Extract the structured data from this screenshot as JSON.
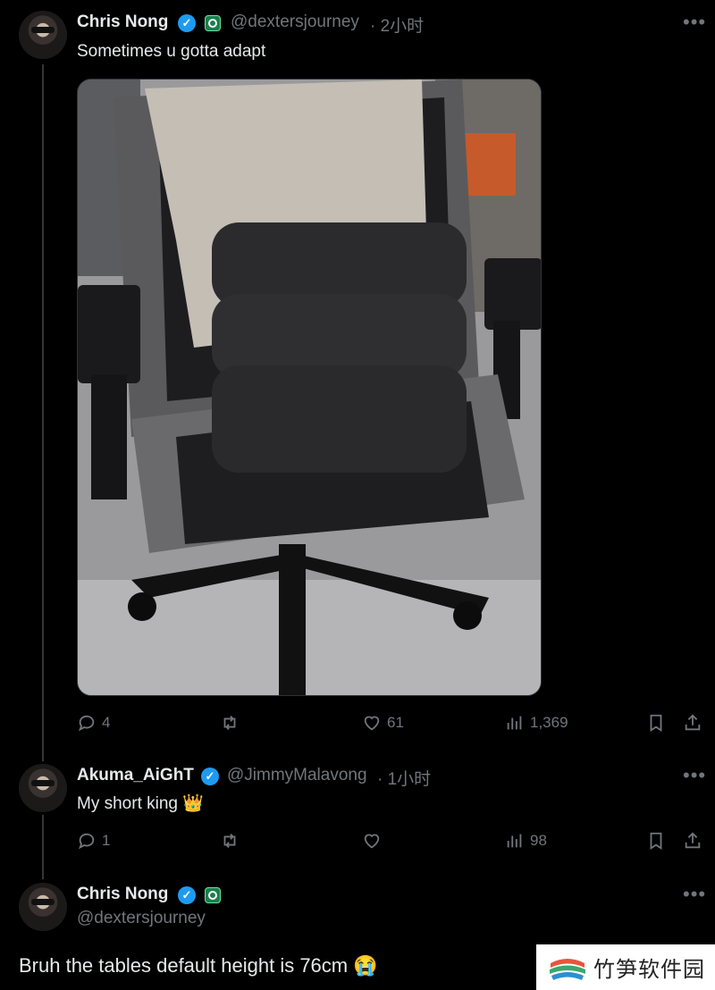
{
  "tweets": [
    {
      "name": "Chris Nong",
      "handle": "@dextersjourney",
      "time": "· 2小时",
      "text": "Sometimes u gotta adapt",
      "replies": "4",
      "retweets": "",
      "likes": "61",
      "views": "1,369"
    },
    {
      "name": "Akuma_AiGhT",
      "handle": "@JimmyMalavong",
      "time": "· 1小时",
      "text": "My short king 👑",
      "replies": "1",
      "retweets": "",
      "likes": "",
      "views": "98"
    },
    {
      "name": "Chris Nong",
      "handle": "@dextersjourney",
      "text": "Bruh the tables default height is 76cm 😭"
    }
  ],
  "watermark": {
    "text": "竹笋软件园"
  },
  "icons": [
    "reply-icon",
    "retweet-icon",
    "like-icon",
    "views-icon",
    "bookmark-icon",
    "share-icon",
    "more-icon",
    "verified-icon"
  ],
  "colors": {
    "background": "#000000",
    "text": "#e7e9ea",
    "muted": "#71767b",
    "verified": "#1d9bf0"
  }
}
